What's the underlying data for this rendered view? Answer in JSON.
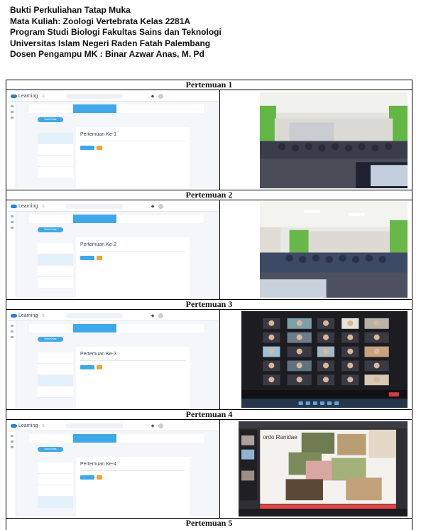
{
  "header": {
    "line1": "Bukti Perkuliahan Tatap Muka",
    "line2": "Mata Kuliah: Zoologi Vertebrata Kelas 2281A",
    "line3": "Program Studi Biologi Fakultas Sains dan Teknologi",
    "line4": "Universitas Islam Negeri Raden Fatah Palembang",
    "line5": "Dosen Pengampu MK : Binar Azwar Anas, M. Pd"
  },
  "meetings": [
    {
      "label": "Pertemuan 1",
      "card_title": "Pertemuan Ke-1"
    },
    {
      "label": "Pertemuan 2",
      "card_title": "Pertemuan Ke-2"
    },
    {
      "label": "Pertemuan 3",
      "card_title": "Pertemuan Ke-3"
    },
    {
      "label": "Pertemuan 4",
      "card_title": "Pertemuan Ke-4"
    },
    {
      "label": "Pertemuan 5"
    }
  ],
  "lms": {
    "logo": "Learning",
    "pill": "Buat Kelas"
  },
  "ppt_slide_title": "ordo Ranidae"
}
